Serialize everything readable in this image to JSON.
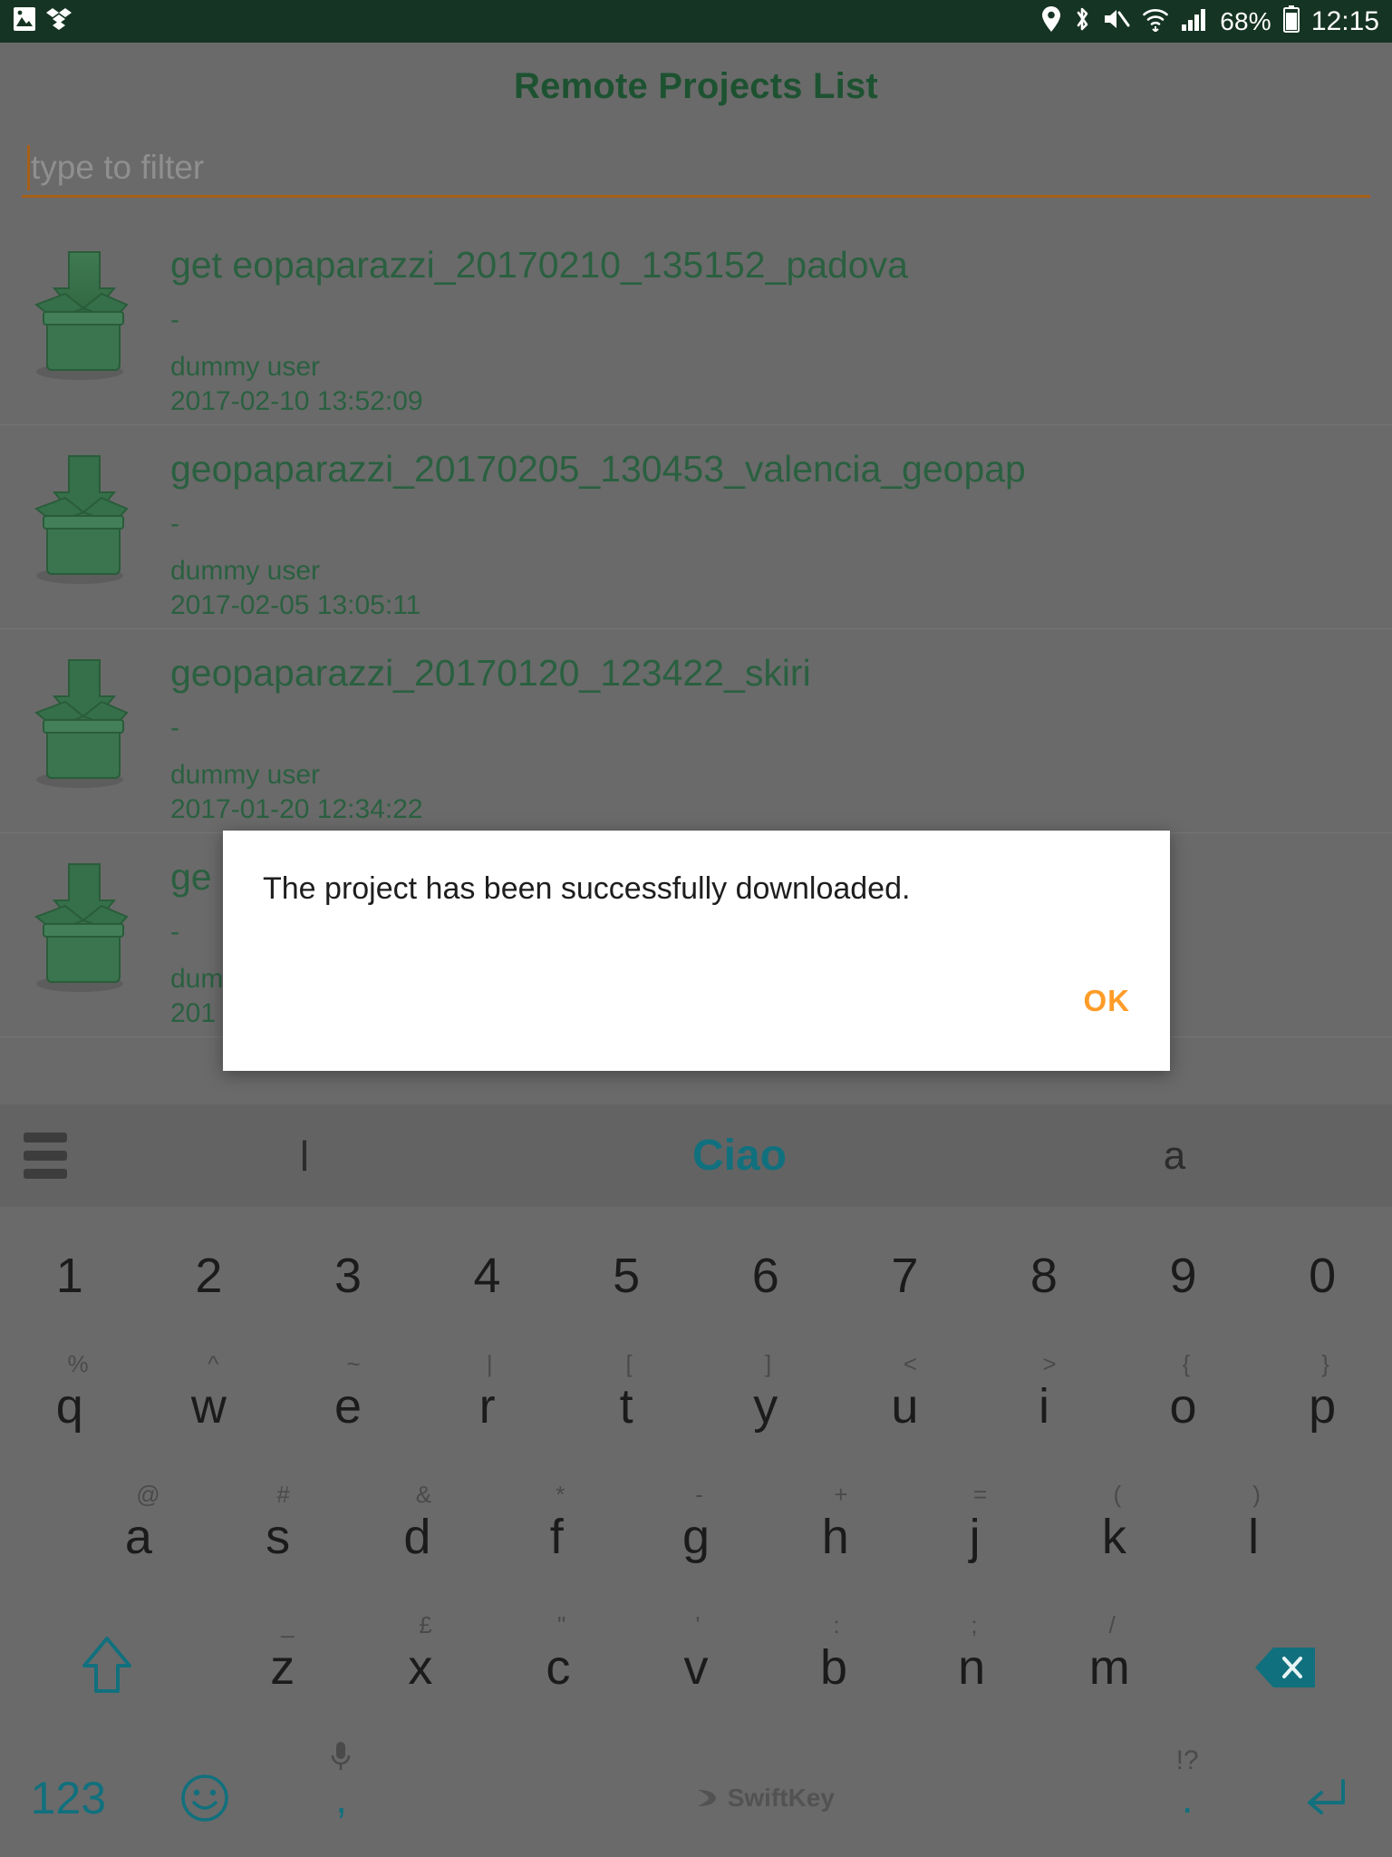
{
  "statusbar": {
    "left_icons": [
      "photo-icon",
      "dropbox-icon"
    ],
    "right_icons": [
      "location-icon",
      "bluetooth-icon",
      "mute-icon",
      "wifi-icon",
      "signal-icon",
      "battery-icon"
    ],
    "battery_percent": "68%",
    "time": "12:15",
    "background_color": "#163423",
    "foreground_color": "#ffffff"
  },
  "app": {
    "title": "Remote Projects List",
    "title_color": "#1d5231",
    "background_color": "#6a6a6a",
    "filter": {
      "value": "",
      "placeholder": "type to filter",
      "accent_color": "#a85f17"
    },
    "list": [
      {
        "icon": "download-box-icon",
        "title": "get eopaparazzi_20170210_135152_padova",
        "description": "-",
        "user": "dummy user",
        "date": "2017-02-10 13:52:09"
      },
      {
        "icon": "download-box-icon",
        "title": "geopaparazzi_20170205_130453_valencia_geopap",
        "description": "-",
        "user": "dummy user",
        "date": "2017-02-05 13:05:11"
      },
      {
        "icon": "download-box-icon",
        "title": "geopaparazzi_20170120_123422_skiri",
        "description": "-",
        "user": "dummy user",
        "date": "2017-01-20 12:34:22"
      },
      {
        "icon": "download-box-icon",
        "title": "ge",
        "description": "-",
        "user": "dum",
        "date": "201"
      }
    ]
  },
  "dialog": {
    "message": "The project has been successfully downloaded.",
    "ok_label": "OK",
    "ok_color": "#ff9c29",
    "background_color": "#ffffff"
  },
  "keyboard": {
    "suggestions": {
      "menu_icon": "hamburger-menu-icon",
      "items": [
        {
          "label": "l",
          "active": false
        },
        {
          "label": "Ciao",
          "active": true
        },
        {
          "label": "a",
          "active": false
        }
      ],
      "active_color": "#11707d"
    },
    "rows": {
      "numbers": [
        {
          "main": "1"
        },
        {
          "main": "2"
        },
        {
          "main": "3"
        },
        {
          "main": "4"
        },
        {
          "main": "5"
        },
        {
          "main": "6"
        },
        {
          "main": "7"
        },
        {
          "main": "8"
        },
        {
          "main": "9"
        },
        {
          "main": "0"
        }
      ],
      "top": [
        {
          "main": "q",
          "alt": "%"
        },
        {
          "main": "w",
          "alt": "^"
        },
        {
          "main": "e",
          "alt": "~"
        },
        {
          "main": "r",
          "alt": "|"
        },
        {
          "main": "t",
          "alt": "["
        },
        {
          "main": "y",
          "alt": "]"
        },
        {
          "main": "u",
          "alt": "<"
        },
        {
          "main": "i",
          "alt": ">"
        },
        {
          "main": "o",
          "alt": "{"
        },
        {
          "main": "p",
          "alt": "}"
        }
      ],
      "home": [
        {
          "main": "a",
          "alt": "@"
        },
        {
          "main": "s",
          "alt": "#"
        },
        {
          "main": "d",
          "alt": "&"
        },
        {
          "main": "f",
          "alt": "*"
        },
        {
          "main": "g",
          "alt": "-"
        },
        {
          "main": "h",
          "alt": "+"
        },
        {
          "main": "j",
          "alt": "="
        },
        {
          "main": "k",
          "alt": "("
        },
        {
          "main": "l",
          "alt": ")"
        }
      ],
      "bottom": [
        {
          "main": "z",
          "alt": "_"
        },
        {
          "main": "x",
          "alt": "£"
        },
        {
          "main": "c",
          "alt": "\""
        },
        {
          "main": "v",
          "alt": "'"
        },
        {
          "main": "b",
          "alt": ":"
        },
        {
          "main": "n",
          "alt": ";"
        },
        {
          "main": "m",
          "alt": "/"
        }
      ]
    },
    "shift_key": "shift-icon",
    "backspace_key": "backspace-icon",
    "numeric_key": "123",
    "emoji_key": "emoji-icon",
    "comma_key": ",",
    "comma_alt": "microphone-icon",
    "period_key": ".",
    "period_alt": "!?",
    "space_brand": "SwiftKey",
    "enter_key": "enter-icon",
    "accent_color": "#11707d",
    "key_background": "#6a6a6a"
  }
}
